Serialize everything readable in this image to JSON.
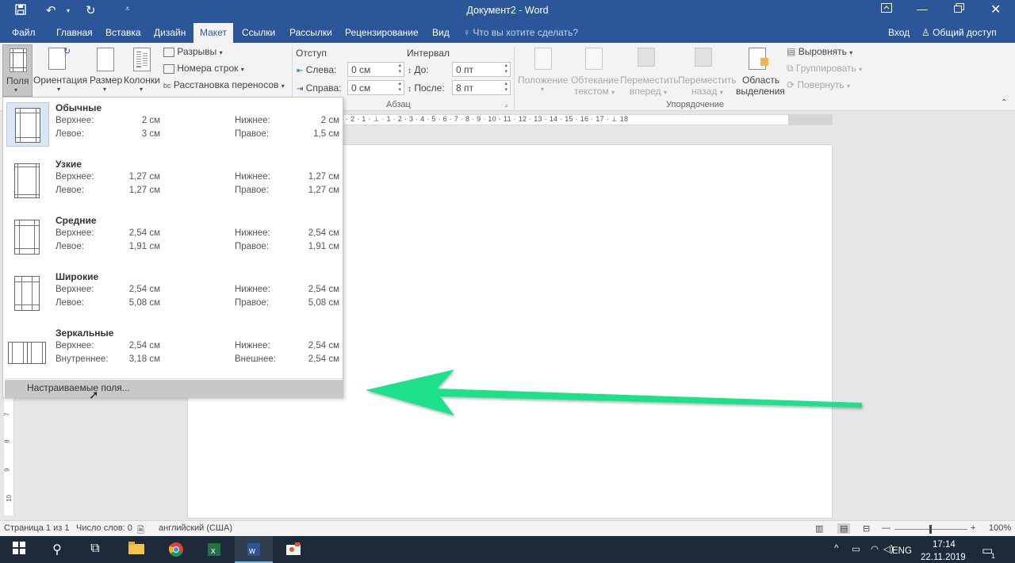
{
  "window": {
    "title": "Документ2 - Word",
    "qat": {
      "save_icon": "save-icon",
      "undo_icon": "undo-icon",
      "redo_icon": "repeat-icon",
      "customize_icon": "customize-qat-icon"
    },
    "controls": {
      "ribbon_options": "ribbon-display-options-icon",
      "minimize": "minimize-icon",
      "restore": "restore-icon",
      "close": "close-icon"
    }
  },
  "tabs": {
    "items": [
      "Файл",
      "Главная",
      "Вставка",
      "Дизайн",
      "Макет",
      "Ссылки",
      "Рассылки",
      "Рецензирование",
      "Вид"
    ],
    "active": "Макет",
    "tell_me": "Что вы хотите сделать?",
    "signin": "Вход",
    "share": "Общий доступ"
  },
  "ribbon": {
    "page_setup": {
      "margins": "Поля",
      "orientation": "Ориентация",
      "size": "Размер",
      "columns": "Колонки",
      "breaks": "Разрывы",
      "line_numbers": "Номера строк",
      "hyphenation": "Расстановка переносов"
    },
    "paragraph": {
      "indent_title": "Отступ",
      "spacing_title": "Интервал",
      "left_label": "Слева:",
      "left_value": "0 см",
      "right_label": "Справа:",
      "right_value": "0 см",
      "before_label": "До:",
      "before_value": "0 пт",
      "after_label": "После:",
      "after_value": "8 пт",
      "group_label": "Абзац"
    },
    "arrange": {
      "position": [
        "Положение",
        ""
      ],
      "wrap_text": [
        "Обтекание",
        "текстом"
      ],
      "bring_forward": [
        "Переместить",
        "вперед"
      ],
      "send_backward": [
        "Переместить",
        "назад"
      ],
      "selection_pane": [
        "Область",
        "выделения"
      ],
      "align": "Выровнять",
      "group": "Группировать",
      "rotate": "Повернуть",
      "group_label": "Упорядочение"
    }
  },
  "ruler": {
    "horizontal": "· 2 · 1 · ⊥ · 1 · 2 · 3 · 4 · 5 · 6 · 7 · 8 · 9 · 10 · 11 · 12 · 13 · 14 · 15 · 16 · 17 · ⊥ 18",
    "vertical": [
      "7",
      "8",
      "9",
      "10"
    ]
  },
  "margins_menu": {
    "presets": [
      {
        "name": "Обычные",
        "top_label": "Верхнее:",
        "top": "2 см",
        "bottom_label": "Нижнее:",
        "bottom": "2 см",
        "left_label": "Левое:",
        "left": "3 см",
        "right_label": "Правое:",
        "right": "1,5 см"
      },
      {
        "name": "Узкие",
        "top_label": "Верхнее:",
        "top": "1,27 см",
        "bottom_label": "Нижнее:",
        "bottom": "1,27 см",
        "left_label": "Левое:",
        "left": "1,27 см",
        "right_label": "Правое:",
        "right": "1,27 см"
      },
      {
        "name": "Средние",
        "top_label": "Верхнее:",
        "top": "2,54 см",
        "bottom_label": "Нижнее:",
        "bottom": "2,54 см",
        "left_label": "Левое:",
        "left": "1,91 см",
        "right_label": "Правое:",
        "right": "1,91 см"
      },
      {
        "name": "Широкие",
        "top_label": "Верхнее:",
        "top": "2,54 см",
        "bottom_label": "Нижнее:",
        "bottom": "2,54 см",
        "left_label": "Левое:",
        "left": "5,08 см",
        "right_label": "Правое:",
        "right": "5,08 см"
      },
      {
        "name": "Зеркальные",
        "top_label": "Верхнее:",
        "top": "2,54 см",
        "bottom_label": "Нижнее:",
        "bottom": "2,54 см",
        "left_label": "Внутреннее:",
        "left": "3,18 см",
        "right_label": "Внешнее:",
        "right": "2,54 см"
      }
    ],
    "custom": "Настраиваемые поля..."
  },
  "annotation": {
    "arrow_color": "#1ee08a",
    "icon": "green-arrow-icon"
  },
  "status": {
    "page": "Страница 1 из 1",
    "words": "Число слов: 0",
    "language": "английский (США)",
    "zoom": "100%"
  },
  "taskbar": {
    "lang": "ENG",
    "time": "17:14",
    "date": "22.11.2019",
    "notifications": "1"
  },
  "colors": {
    "brand": "#2b579a",
    "accent_arrow": "#1ee08a"
  }
}
